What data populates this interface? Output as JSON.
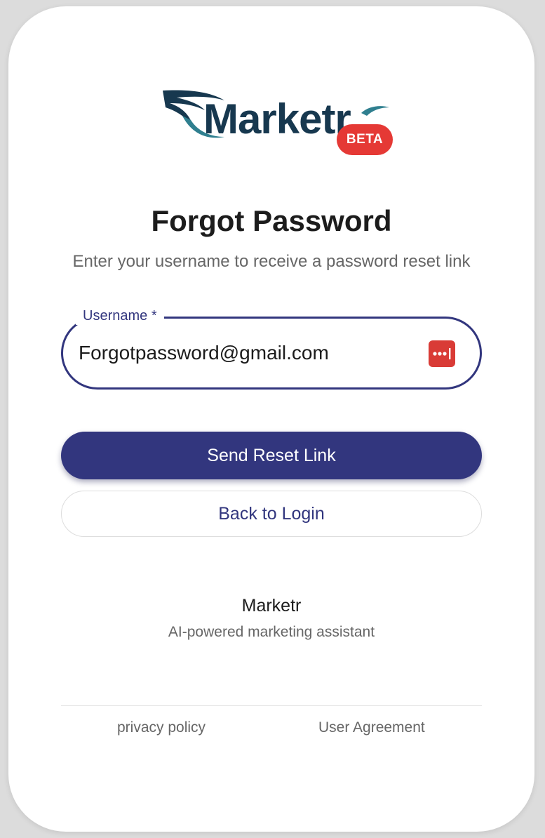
{
  "logo": {
    "wordmark": "Marketr",
    "badge": "BETA"
  },
  "form": {
    "title": "Forgot Password",
    "subtitle": "Enter your username to receive a password reset link",
    "username_label": "Username *",
    "username_value": "Forgotpassword@gmail.com",
    "password_manager_icon": "password-dots-icon"
  },
  "actions": {
    "send_label": "Send Reset Link",
    "back_label": "Back to Login"
  },
  "brand": {
    "name": "Marketr",
    "tagline": "AI-powered marketing assistant"
  },
  "footer": {
    "privacy": "privacy policy",
    "agreement": "User Agreement"
  },
  "colors": {
    "primary": "#32367e",
    "badge": "#e53935",
    "logo_dark": "#17384f"
  }
}
